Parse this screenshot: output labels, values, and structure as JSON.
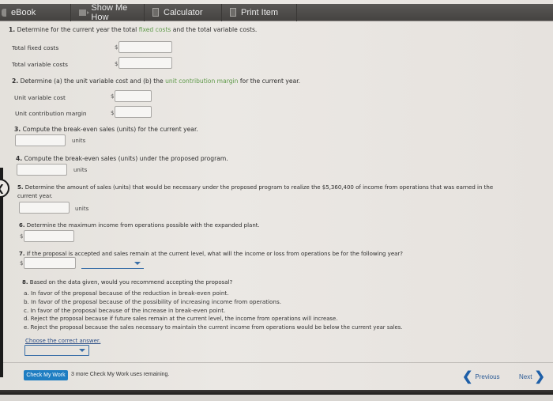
{
  "toolbar": {
    "items": [
      {
        "label": "eBook",
        "icon": "book-icon"
      },
      {
        "label": "Show Me How",
        "icon": "video-icon"
      },
      {
        "label": "Calculator",
        "icon": "calculator-icon"
      },
      {
        "label": "Print Item",
        "icon": "print-icon"
      }
    ]
  },
  "questions": {
    "q1": {
      "number": "1.",
      "text_before": "Determine for the current year the total ",
      "link": "fixed costs",
      "text_after": " and the total variable costs.",
      "fields": [
        {
          "label": "Total fixed costs",
          "prefix": "$",
          "value": ""
        },
        {
          "label": "Total variable costs",
          "prefix": "$",
          "value": ""
        }
      ]
    },
    "q2": {
      "number": "2.",
      "text_before": "Determine (a) the unit variable cost and (b) the ",
      "link": "unit contribution margin",
      "text_after": " for the current year.",
      "fields": [
        {
          "label": "Unit variable cost",
          "prefix": "$",
          "value": ""
        },
        {
          "label": "Unit contribution margin",
          "prefix": "$",
          "value": ""
        }
      ]
    },
    "q3": {
      "number": "3.",
      "text": "Compute the break-even sales (units) for the current year.",
      "suffix": "units",
      "value": ""
    },
    "q4": {
      "number": "4.",
      "text": "Compute the break-even sales (units) under the proposed program.",
      "suffix": "units",
      "value": ""
    },
    "q5": {
      "number": "5.",
      "text": "Determine the amount of sales (units) that would be necessary under the proposed program to realize the $5,360,400 of income from operations that was earned in the",
      "text_line2": "current year.",
      "suffix": "units",
      "value": ""
    },
    "q6": {
      "number": "6.",
      "text": "Determine the maximum income from operations possible with the expanded plant.",
      "prefix": "$",
      "value": ""
    },
    "q7": {
      "number": "7.",
      "text": "If the proposal is accepted and sales remain at the current level, what will the income or loss from operations be for the following year?",
      "prefix": "$",
      "value": "",
      "select_value": ""
    },
    "q8": {
      "number": "8.",
      "text": "Based on the data given, would you recommend accepting the proposal?",
      "options": [
        {
          "letter": "a.",
          "text": "In favor of the proposal because of the reduction in break-even point."
        },
        {
          "letter": "b.",
          "text": "In favor of the proposal because of the possibility of increasing income from operations."
        },
        {
          "letter": "c.",
          "text": "In favor of the proposal because of the increase in break-even point."
        },
        {
          "letter": "d.",
          "text": "Reject the proposal because if future sales remain at the current level, the income from operations will increase."
        },
        {
          "letter": "e.",
          "text": "Reject the proposal because the sales necessary to maintain the current income from operations would be below the current year sales."
        }
      ],
      "choose_label": "Choose the correct answer.",
      "select_value": ""
    }
  },
  "footer": {
    "check_button": "Check My Work",
    "remaining": "3 more Check My Work uses remaining.",
    "previous": "Previous",
    "next": "Next"
  },
  "colors": {
    "link_green": "#5f9a4a",
    "button_blue": "#1f7ec2",
    "nav_blue": "#1e5fa8"
  }
}
